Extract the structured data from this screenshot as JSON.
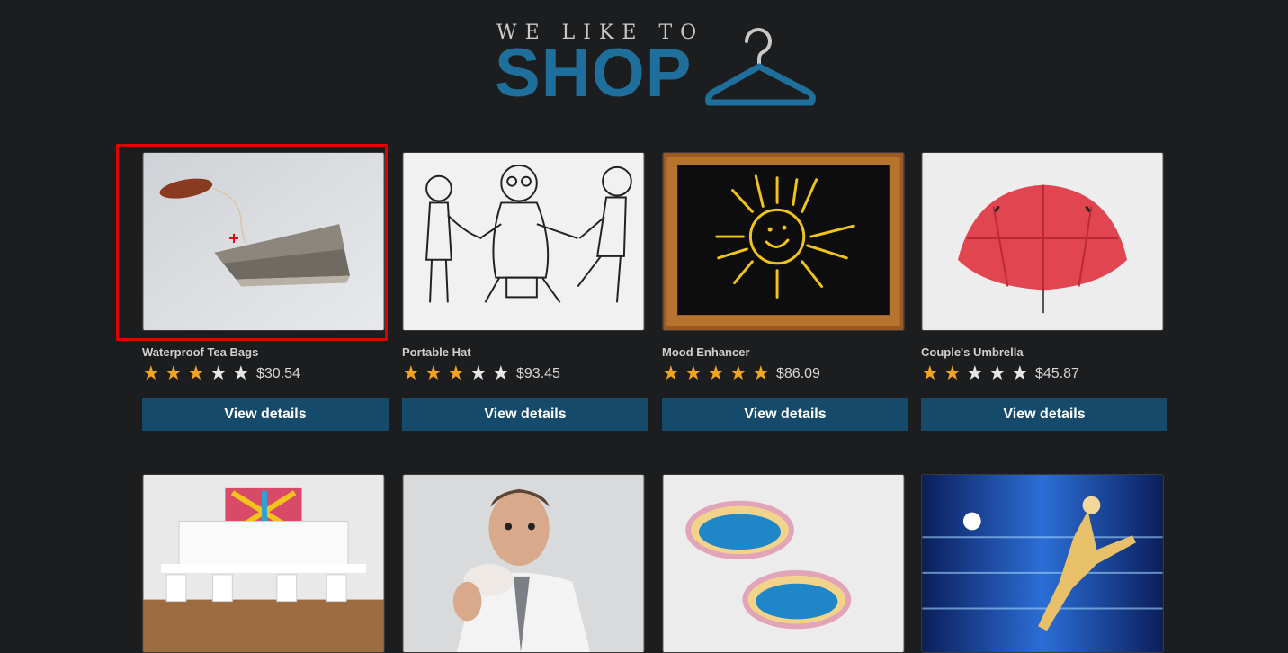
{
  "logo": {
    "tagline": "WE LIKE TO",
    "word": "SHOP",
    "icon": "hanger-icon"
  },
  "colors": {
    "background": "#1c1d1f",
    "brand": "#1f6f9c",
    "button": "#164a6a",
    "star_on": "#f2a41f",
    "star_off": "#e6e6e6",
    "highlight": "#e00000"
  },
  "products": [
    {
      "name": "Waterproof Tea Bags",
      "rating": 3,
      "price": "$30.54",
      "button": "View details",
      "image": "tea-bag-image"
    },
    {
      "name": "Portable Hat",
      "rating": 3,
      "price": "$93.45",
      "button": "View details",
      "image": "cartoon-sketch-image"
    },
    {
      "name": "Mood Enhancer",
      "rating": 5,
      "price": "$86.09",
      "button": "View details",
      "image": "chalkboard-sun-image"
    },
    {
      "name": "Couple's Umbrella",
      "rating": 2,
      "price": "$45.87",
      "button": "View details",
      "image": "red-umbrella-image"
    },
    {
      "name": "",
      "rating": null,
      "price": "",
      "button": "",
      "image": "team-room-image"
    },
    {
      "name": "",
      "rating": null,
      "price": "",
      "button": "",
      "image": "man-eating-image"
    },
    {
      "name": "",
      "rating": null,
      "price": "",
      "button": "",
      "image": "paddling-pools-image"
    },
    {
      "name": "",
      "rating": null,
      "price": "",
      "button": "",
      "image": "speed-runner-image"
    }
  ]
}
